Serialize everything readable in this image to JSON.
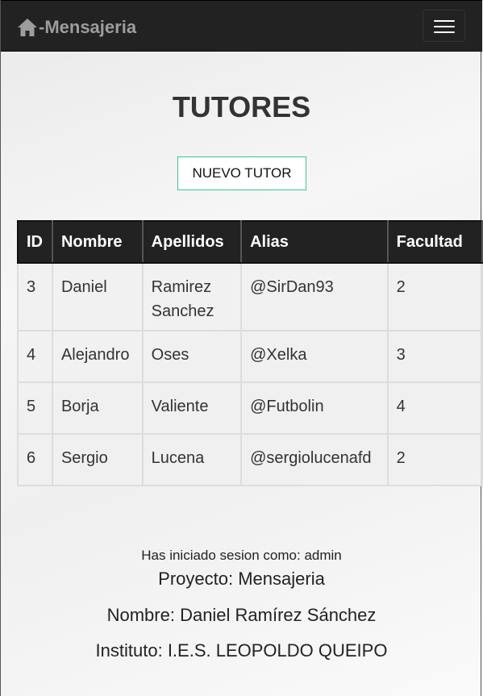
{
  "navbar": {
    "brand": "-Mensajeria",
    "home_icon": "home-icon",
    "toggle_icon": "hamburger-menu-icon"
  },
  "page": {
    "title": "TUTORES",
    "new_button": "NUEVO TUTOR"
  },
  "table": {
    "headers": [
      "ID",
      "Nombre",
      "Apellidos",
      "Alias",
      "Facultad"
    ],
    "rows": [
      {
        "id": "3",
        "nombre": "Daniel",
        "apellidos": "Ramirez Sanchez",
        "alias": "@SirDan93",
        "facultad": "2"
      },
      {
        "id": "4",
        "nombre": "Alejandro",
        "apellidos": "Oses",
        "alias": "@Xelka",
        "facultad": "3"
      },
      {
        "id": "5",
        "nombre": "Borja",
        "apellidos": "Valiente",
        "alias": "@Futbolin",
        "facultad": "4"
      },
      {
        "id": "6",
        "nombre": "Sergio",
        "apellidos": "Lucena",
        "alias": "@sergiolucenafd",
        "facultad": "2"
      }
    ]
  },
  "footer": {
    "session": "Has iniciado sesion como: admin",
    "project": "Proyecto: Mensajeria",
    "name": "Nombre: Daniel Ramírez Sánchez",
    "institute": "Instituto: I.E.S. LEOPOLDO QUEIPO"
  },
  "colors": {
    "navbar_bg": "#222222",
    "brand_text": "#9d9d9d",
    "button_border": "#39c39a",
    "table_header_bg": "#222222"
  }
}
